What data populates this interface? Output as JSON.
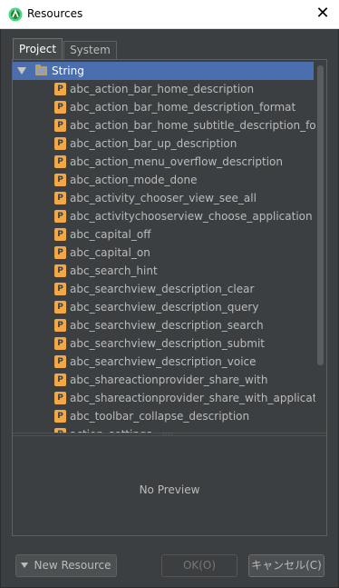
{
  "window": {
    "title": "Resources",
    "close_glyph": "✕"
  },
  "tabs": [
    {
      "label": "Project",
      "active": true
    },
    {
      "label": "System",
      "active": false
    }
  ],
  "tree": {
    "root_label": "String",
    "item_badge": "P",
    "items": [
      "abc_action_bar_home_description",
      "abc_action_bar_home_description_format",
      "abc_action_bar_home_subtitle_description_format",
      "abc_action_bar_up_description",
      "abc_action_menu_overflow_description",
      "abc_action_mode_done",
      "abc_activity_chooser_view_see_all",
      "abc_activitychooserview_choose_application",
      "abc_capital_off",
      "abc_capital_on",
      "abc_search_hint",
      "abc_searchview_description_clear",
      "abc_searchview_description_query",
      "abc_searchview_description_search",
      "abc_searchview_description_submit",
      "abc_searchview_description_voice",
      "abc_shareactionprovider_share_with",
      "abc_shareactionprovider_share_with_application",
      "abc_toolbar_collapse_description",
      "action_settings"
    ]
  },
  "preview": {
    "text": "No Preview"
  },
  "buttons": {
    "new_resource": "New Resource",
    "ok": "OK(O)",
    "cancel": "キャンセル(C)"
  },
  "colors": {
    "selection": "#4b6eaf",
    "badge": "#f2a847",
    "background": "#3c3f41"
  }
}
